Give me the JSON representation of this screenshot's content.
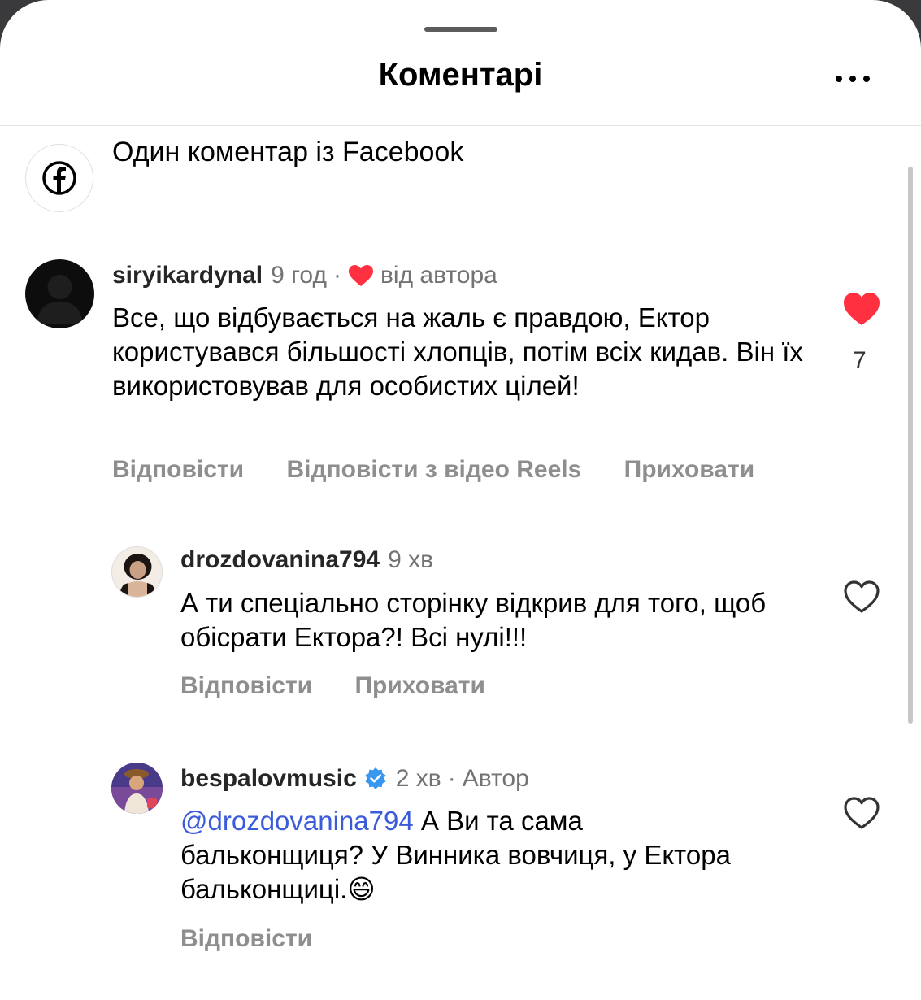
{
  "header": {
    "title": "Коментарі"
  },
  "facebook_note": {
    "text": "Один коментар із Facebook"
  },
  "comments": [
    {
      "username": "siryikardynal",
      "time": "9 год",
      "separator": "·",
      "badge": "від автора",
      "text": "Все, що відбувається на жаль є правдою, Ектор користувався більшості хлопців, потім всіх кидав. Він їх використовував для особистих цілей!",
      "actions": [
        "Відповісти",
        "Відповісти з відео Reels",
        "Приховати"
      ],
      "likes": "7",
      "liked": true
    },
    {
      "username": "drozdovanina794",
      "time": "9 хв",
      "text": "А ти спеціально сторінку відкрив для того, щоб обісрати Ектора?! Всі нулі!!!",
      "actions": [
        "Відповісти",
        "Приховати"
      ],
      "liked": false
    },
    {
      "username": "bespalovmusic",
      "verified": true,
      "time": "2 хв",
      "separator": "·",
      "badge": "Автор",
      "mention": "@drozdovanina794",
      "text": " А Ви та сама бальконщиця? У Винника вовчиця, у Ектора бальконщиці.",
      "emoji": "😄",
      "actions": [
        "Відповісти"
      ],
      "liked": false
    }
  ],
  "colors": {
    "heart": "#ff3040",
    "verified": "#3897f0",
    "mention": "#3b5bdb"
  }
}
